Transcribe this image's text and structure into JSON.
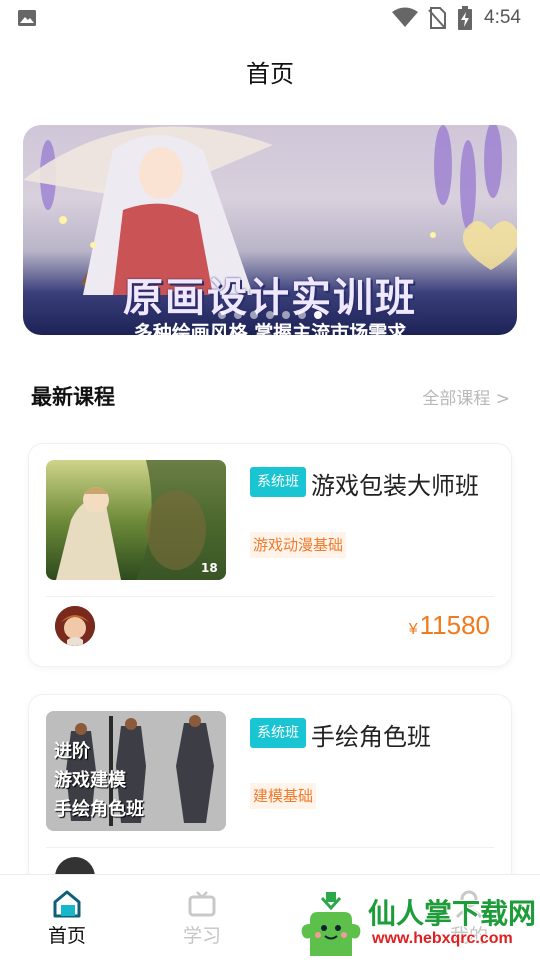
{
  "status_bar": {
    "time": "4:54",
    "icons": [
      "image-icon",
      "wifi-icon",
      "no-sim-icon",
      "battery-charging-icon"
    ]
  },
  "header": {
    "title": "首页"
  },
  "banner": {
    "title": "原画设计实训班",
    "subtitle": "多种绘画风格 掌握主流市场需求",
    "slide_count": 7,
    "active_slide": 7
  },
  "latest_courses": {
    "title": "最新课程",
    "all_link": "全部课程 >",
    "courses": [
      {
        "badge": "系统班",
        "name": "游戏包装大师班",
        "tag": "游戏动漫基础",
        "price_symbol": "¥",
        "price": "11580"
      },
      {
        "badge": "系统班",
        "name": "手绘角色班",
        "tag": "建模基础",
        "thumb_lines": [
          "进阶",
          "游戏建模",
          "手绘角色班"
        ]
      }
    ]
  },
  "bottom_nav": {
    "items": [
      {
        "label": "首页",
        "icon": "home-icon",
        "active": true
      },
      {
        "label": "学习",
        "icon": "tv-icon",
        "active": false
      },
      {
        "label": "我的",
        "icon": "user-icon",
        "active": false
      }
    ]
  },
  "watermark": {
    "name": "仙人掌下载网",
    "url": "www.hebxqrc.com"
  },
  "colors": {
    "accent": "#19c5d3",
    "price": "#f07a1c",
    "tag_text": "#ef7b2c",
    "tag_bg": "#fff3ea"
  }
}
